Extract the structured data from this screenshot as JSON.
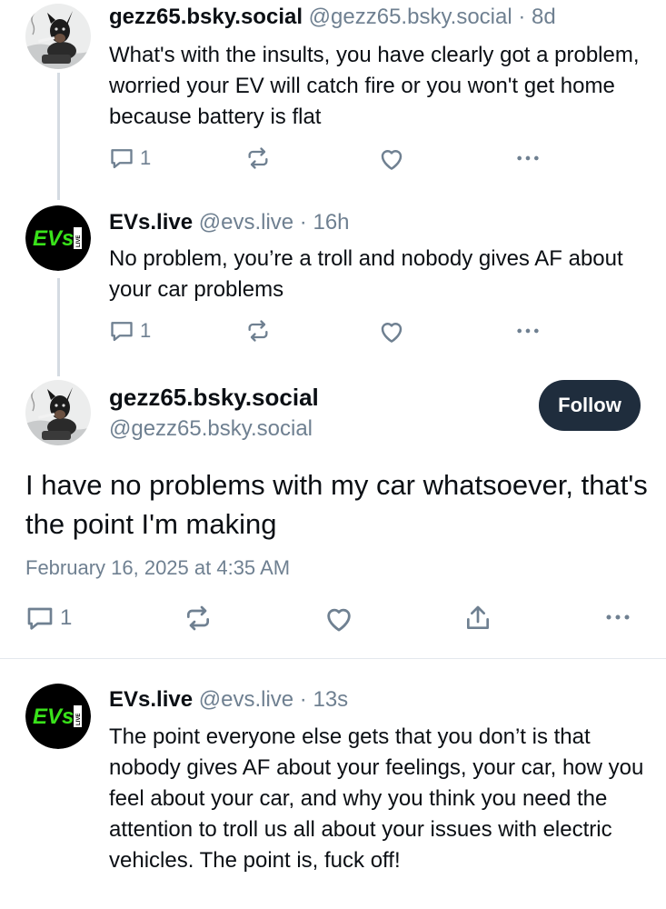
{
  "posts": [
    {
      "author": "gezz65.bsky.social",
      "handle": "@gezz65.bsky.social",
      "dot": "·",
      "time": "8d",
      "text": "What's with the insults, you have clearly got a problem, worried your EV will catch fire or you won't get home because battery is flat",
      "reply_count": "1",
      "avatar_icon": "dog-avatar-icon"
    },
    {
      "author": "EVs.live",
      "handle": "@evs.live",
      "dot": "·",
      "time": "16h",
      "text": "No problem, you’re a troll and nobody gives AF about your car problems",
      "reply_count": "1",
      "avatar_icon": "evs-live-logo-icon"
    }
  ],
  "main_post": {
    "author": "gezz65.bsky.social",
    "handle": "@gezz65.bsky.social",
    "follow_label": "Follow",
    "text": "I have no problems with my car whatsoever, that's the point I'm making",
    "date": "February 16, 2025 at 4:35 AM",
    "reply_count": "1"
  },
  "reply": {
    "author": "EVs.live",
    "handle": "@evs.live",
    "dot": "·",
    "time": "13s",
    "text": "The point everyone else gets that you don’t is that nobody gives AF about your feelings, your car, how you feel about your car, and why you think you need the attention to troll us all about your issues with electric vehicles.  The point is, fuck off!"
  },
  "logo": {
    "main": "EVs",
    "badge": "LIVE"
  },
  "colors": {
    "follow_bg": "#1f2d3d",
    "muted": "#6f8091",
    "logo_green": "#39e21a",
    "thread_line": "#d4dbe2"
  }
}
